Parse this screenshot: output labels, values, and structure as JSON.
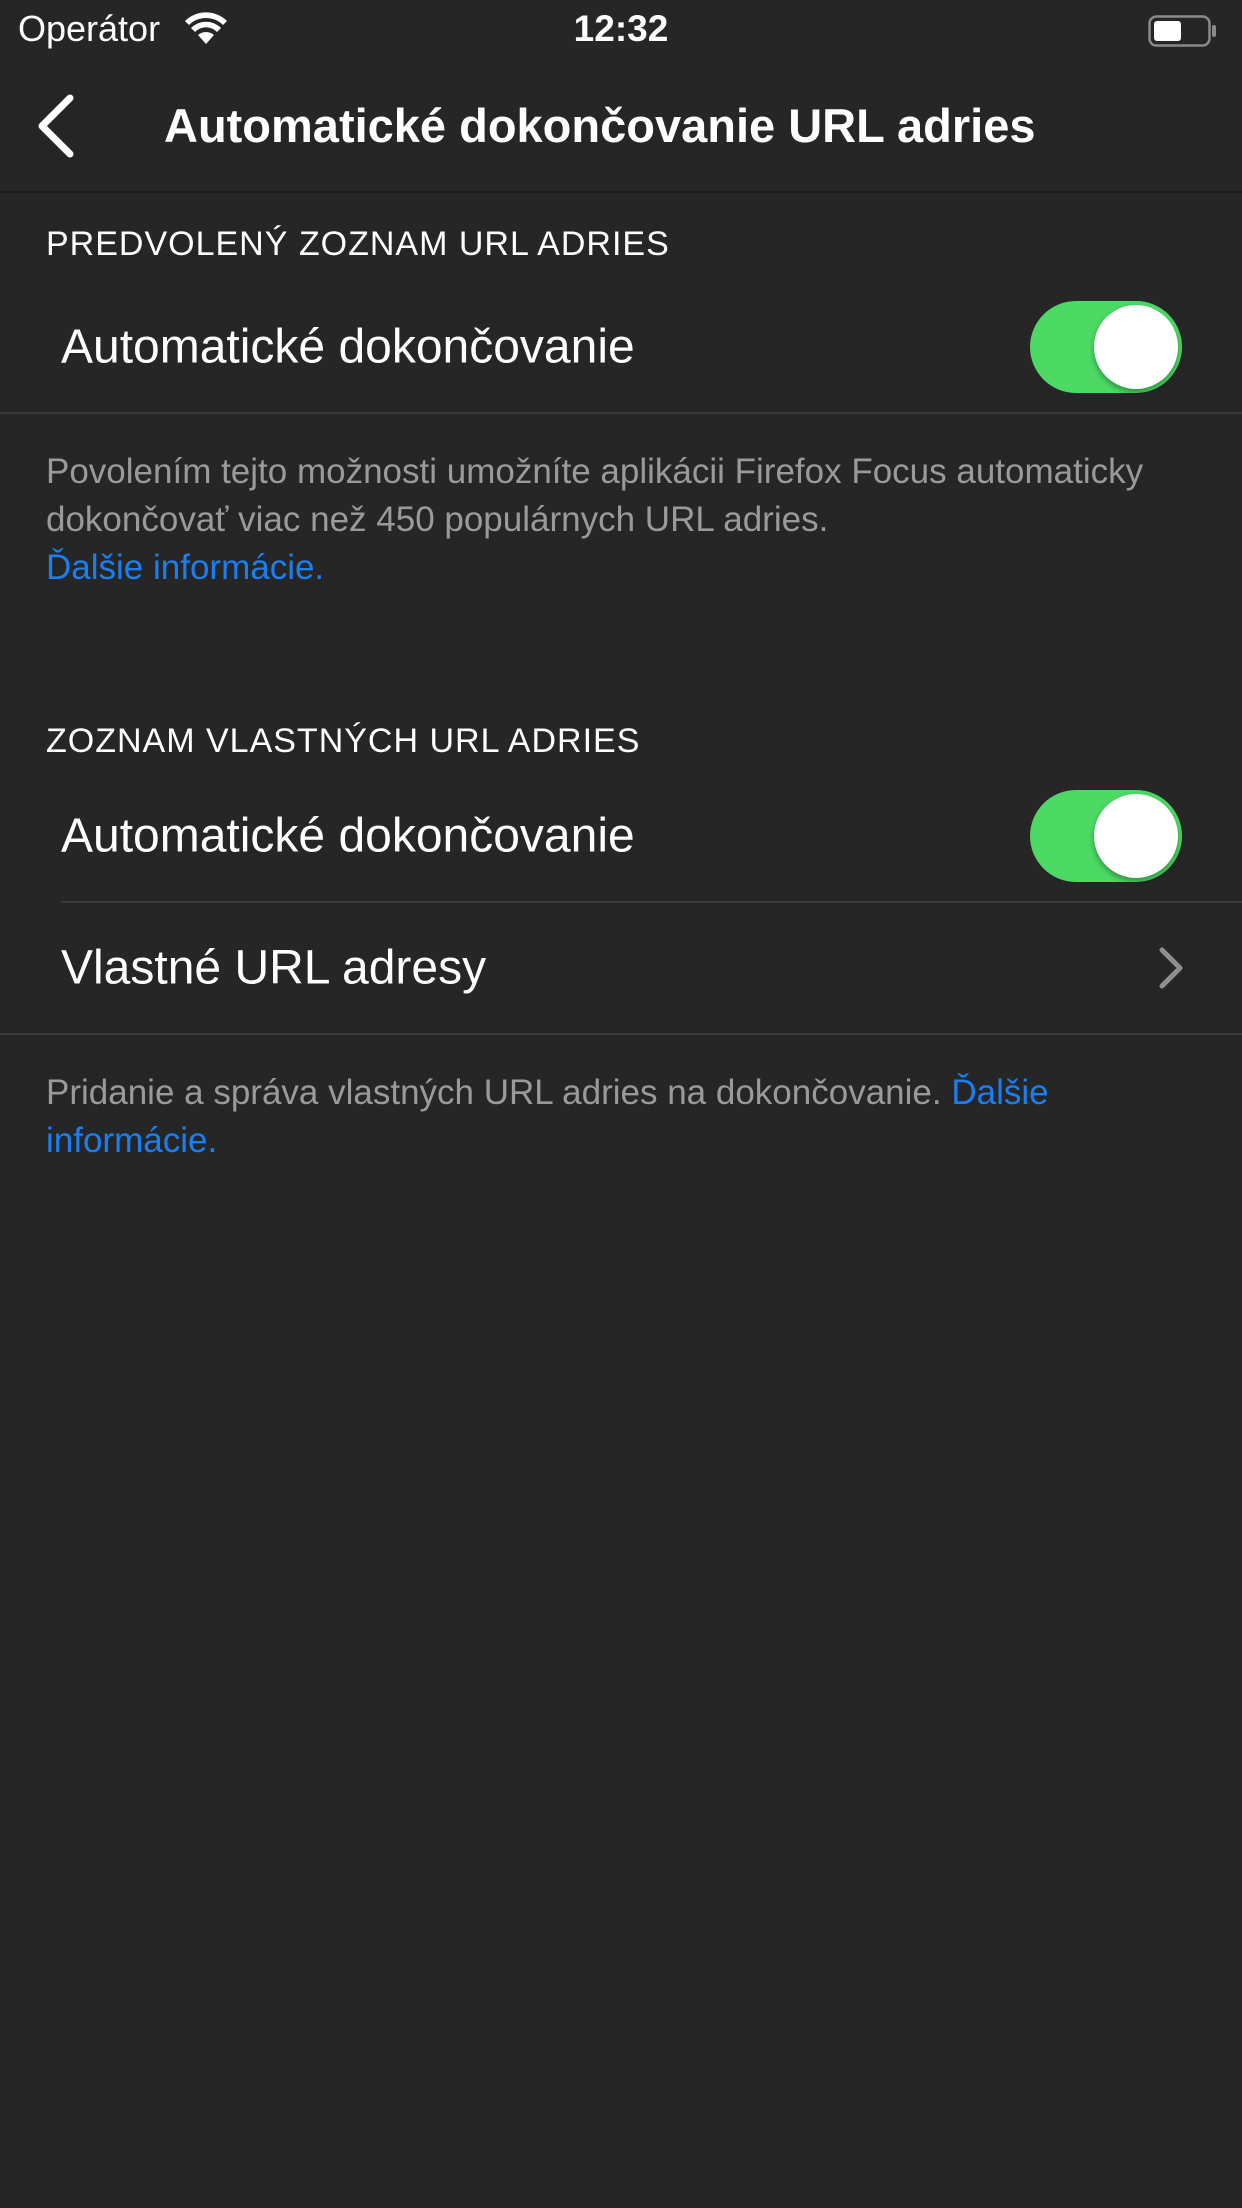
{
  "status_bar": {
    "carrier": "Operátor",
    "time": "12:32",
    "battery_level": 0.45
  },
  "nav": {
    "title": "Automatické dokončovanie URL adries"
  },
  "section_default": {
    "header": "PREDVOLENÝ ZOZNAM URL ADRIES",
    "autocomplete_label": "Automatické dokončovanie",
    "autocomplete_on": true,
    "footer_text": "Povolením tejto možnosti umožníte aplikácii Firefox Focus automaticky dokončovať viac než 450 populárnych URL adries.",
    "footer_link": "Ďalšie informácie."
  },
  "section_custom": {
    "header": "ZOZNAM VLASTNÝCH URL ADRIES",
    "autocomplete_label": "Automatické dokončovanie",
    "autocomplete_on": true,
    "custom_urls_label": "Vlastné URL adresy",
    "footer_text": "Pridanie a správa vlastných URL adries na dokončovanie.",
    "footer_link": "Ďalšie informácie."
  },
  "colors": {
    "background": "#262626",
    "toggle_on": "#4cd964",
    "link": "#1a7ff0",
    "footer_text": "#9a9a9a"
  }
}
